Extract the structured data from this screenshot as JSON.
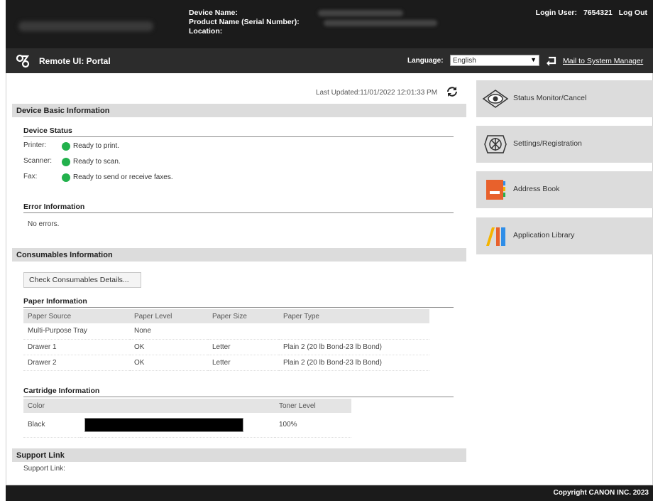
{
  "header": {
    "device_labels": [
      "Device Name:",
      "Product Name (Serial Number):",
      "Location:"
    ],
    "login_label": "Login User:",
    "login_user": "7654321",
    "logout": "Log Out"
  },
  "portal": {
    "title": "Remote UI: Portal",
    "language_label": "Language:",
    "language_value": "English",
    "mail_link": "Mail to System Manager"
  },
  "main": {
    "last_updated": "Last Updated:11/01/2022 12:01:33 PM",
    "device_basic": {
      "heading": "Device Basic Information",
      "status_heading": "Device Status",
      "rows": [
        {
          "label": "Printer:",
          "status": "Ready to print."
        },
        {
          "label": "Scanner:",
          "status": "Ready to scan."
        },
        {
          "label": "Fax:",
          "status": "Ready to send or receive faxes."
        }
      ],
      "error_heading": "Error Information",
      "error_text": "No errors."
    },
    "consumables": {
      "heading": "Consumables Information",
      "check_button": "Check Consumables Details...",
      "paper_heading": "Paper Information",
      "paper_columns": [
        "Paper Source",
        "Paper Level",
        "Paper Size",
        "Paper Type"
      ],
      "paper_rows": [
        [
          "Multi-Purpose Tray",
          "None",
          "",
          ""
        ],
        [
          "Drawer 1",
          "OK",
          "Letter",
          "Plain 2 (20 lb Bond-23 lb Bond)"
        ],
        [
          "Drawer 2",
          "OK",
          "Letter",
          "Plain 2 (20 lb Bond-23 lb Bond)"
        ]
      ],
      "cartridge_heading": "Cartridge Information",
      "cartridge_columns": [
        "Color",
        "",
        "Toner Level"
      ],
      "cartridge_row": {
        "color": "Black",
        "level": "100%",
        "level_fraction": 1.0
      }
    },
    "support": {
      "heading": "Support Link",
      "label": "Support Link:"
    }
  },
  "side_menu": [
    {
      "label": "Status Monitor/Cancel",
      "icon": "eye-icon"
    },
    {
      "label": "Settings/Registration",
      "icon": "settings-gear-icon"
    },
    {
      "label": "Address Book",
      "icon": "address-book-icon"
    },
    {
      "label": "Application Library",
      "icon": "application-library-icon"
    }
  ],
  "footer": {
    "copyright": "Copyright CANON INC. 2023"
  },
  "colors": {
    "header_bg": "#1b1b1b",
    "ready_green": "#22b14c",
    "address_book_orange": "#e8612c",
    "app_yellow": "#f5b400",
    "app_blue": "#2f8ee8"
  }
}
